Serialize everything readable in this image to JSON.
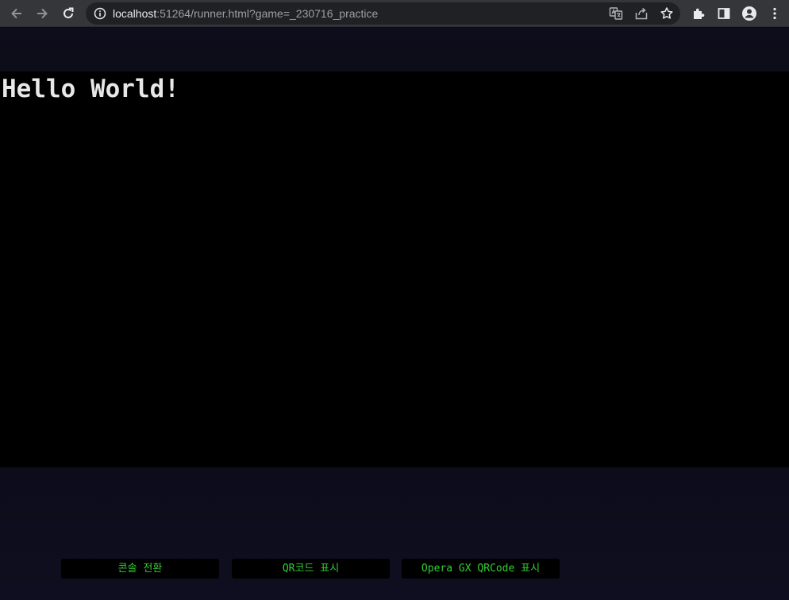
{
  "browser": {
    "url_host": "localhost",
    "url_rest": ":51264/runner.html?game=_230716_practice",
    "icons": [
      "back-arrow-icon",
      "forward-arrow-icon",
      "reload-icon",
      "info-icon",
      "translate-icon",
      "share-icon",
      "bookmark-star-icon",
      "extensions-icon",
      "side-panel-icon",
      "profile-icon",
      "more-menu-icon"
    ]
  },
  "game": {
    "text": "Hello World!",
    "background": "#000000",
    "text_color": "#e8e8e8"
  },
  "runner_buttons": {
    "console_toggle": "콘솔 전환",
    "show_qr": "QR코드 표시",
    "show_opera_qr": "Opera GX QRCode 표시"
  },
  "colors": {
    "button_text": "#33cc33",
    "page_background": "#0c0c18"
  }
}
